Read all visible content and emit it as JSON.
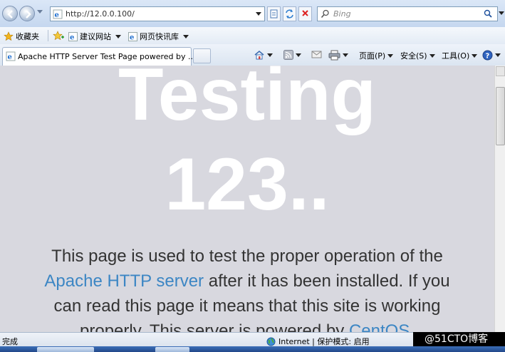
{
  "address_bar": {
    "url": "http://12.0.0.100/",
    "search_placeholder": "Bing"
  },
  "favorites_bar": {
    "favorites_label": "收藏夹",
    "items": [
      {
        "label": "建议网站"
      },
      {
        "label": "网页快讯库"
      }
    ]
  },
  "tab_bar": {
    "active_tab_title": "Apache HTTP Server Test Page powered by ..."
  },
  "command_bar": {
    "page_label": "页面(P)",
    "safety_label": "安全(S)",
    "tools_label": "工具(O)"
  },
  "page": {
    "heading_line1": "Testing",
    "heading_line2": "123..",
    "para_text1": "This page is used to test the proper operation of the",
    "para_link1": "Apache HTTP server",
    "para_text2": " after it has been installed. If you can read this page it means that this site is working properly. This server is powered by ",
    "para_link2": "CentOS",
    "para_text3": "."
  },
  "status_bar": {
    "status_text": "完成",
    "zone_text": "Internet | 保护模式: 启用",
    "watermark": "@51CTO博客"
  },
  "colors": {
    "content_bg": "#d8d8df",
    "link": "#3c86c4",
    "heading": "#ffffff"
  }
}
